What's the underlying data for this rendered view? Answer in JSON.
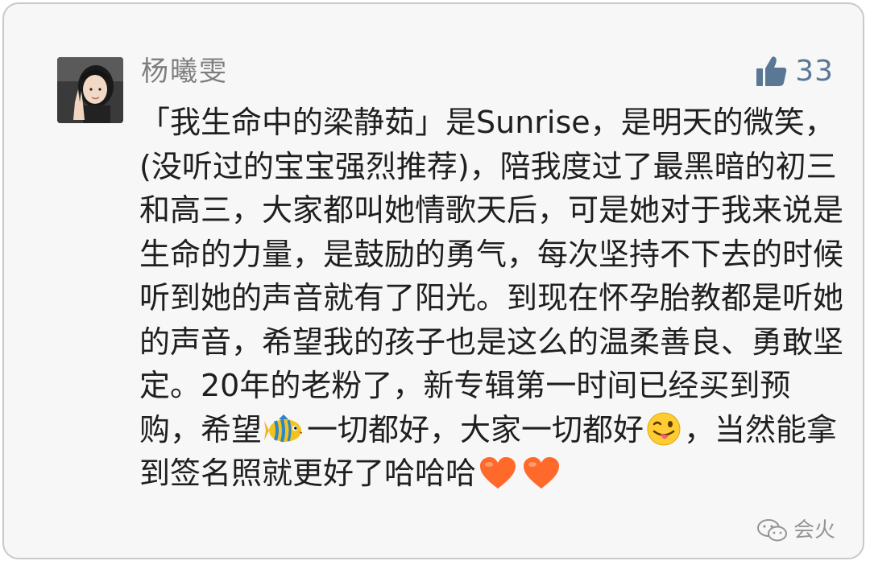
{
  "comment": {
    "username": "杨曦雯",
    "likes": "33",
    "text_segments": {
      "part1": "「我生命中的梁静茹」是Sunrise，是明天的微笑，(没听过的宝宝强烈推荐)，陪我度过了最黑暗的初三和高三，大家都叫她情歌天后，可是她对于我来说是生命的力量，是鼓励的勇气，每次坚持不下去的时候听到她的声音就有了阳光。到现在怀孕胎教都是听她的声音，希望我的孩子也是这么的温柔善良、勇敢坚定。20年的老粉了，新专辑第一时间已经买到预购，希望",
      "part2": "一切都好，大家一切都好",
      "part3": "，当然能拿到签名照就更好了哈哈哈"
    },
    "emojis": [
      "tropical-fish-icon",
      "winking-tongue-face-icon",
      "orange-heart-icon",
      "orange-heart-icon"
    ]
  },
  "watermark": {
    "label": "会火"
  },
  "colors": {
    "username": "#7e7e7e",
    "like": "#5a7795",
    "text": "#1f1f1f",
    "background": "#f7f7f7",
    "heart": "#ff6a2b"
  }
}
